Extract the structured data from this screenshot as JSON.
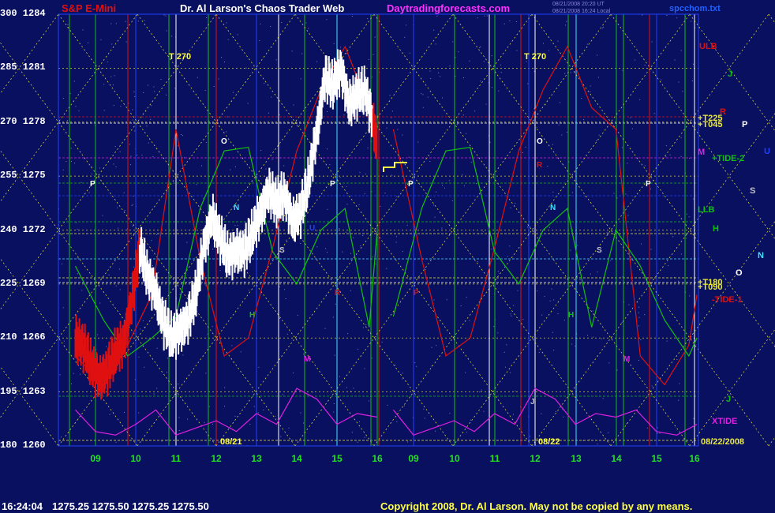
{
  "header": {
    "instrument": "S&P E-Mini",
    "title": "Dr. Al Larson's Chaos Trader Web",
    "site": "Daytradingforecasts.com",
    "file": "spcchom.txt",
    "tiny_line1": "08/21/2008 20:20 UT",
    "tiny_line2": "08/21/2008 16:24 Local"
  },
  "footer": {
    "time": "16:24:04",
    "quote": "1275.25 1275.50 1275.25 1275.50",
    "copyright": "Copyright 2008, Dr. Al Larson. May not be copied by any means."
  },
  "colors": {
    "background": "#0a1060",
    "price_bar": "#ffffff",
    "red": "#e01010",
    "green": "#10c010",
    "magenta": "#e020e0",
    "yellow_grid": "#e8e840",
    "blue_line": "#2040ff",
    "cyan_line": "#40e0ff"
  },
  "chart_data": {
    "type": "line",
    "title": "S&P E-Mini",
    "y_axis": {
      "left_labels": [
        "300",
        "285",
        "270",
        "255",
        "240",
        "225",
        "210",
        "195",
        "180"
      ],
      "right_labels": [
        "1284",
        "1281",
        "1278",
        "1275",
        "1272",
        "1269",
        "1266",
        "1263",
        "1260"
      ],
      "price_range": [
        1260,
        1284
      ],
      "wave_range": [
        180,
        300
      ]
    },
    "x_axis": {
      "hour_ticks": [
        "09",
        "10",
        "11",
        "12",
        "13",
        "14",
        "15",
        "16",
        "09",
        "10",
        "11",
        "12",
        "13",
        "14",
        "15",
        "16"
      ],
      "dates": [
        "08/21",
        "08/22"
      ]
    },
    "vertical_labels": [
      "T 270",
      "T 270"
    ],
    "price_series": {
      "name": "S&P E-Mini price",
      "x_hours": [
        8.5,
        8.7,
        8.9,
        9.1,
        9.3,
        9.5,
        9.7,
        9.9,
        10.1,
        10.3,
        10.5,
        10.7,
        10.9,
        11.1,
        11.3,
        11.5,
        11.7,
        11.9,
        12.1,
        12.3,
        12.5,
        12.7,
        12.9,
        13.1,
        13.3,
        13.5,
        13.7,
        13.9,
        14.1,
        14.3,
        14.5,
        14.7,
        14.9,
        15.1,
        15.3,
        15.5,
        15.7,
        15.9,
        16.0
      ],
      "y_price": [
        1266.0,
        1265.5,
        1264.5,
        1263.8,
        1264.2,
        1265.2,
        1265.8,
        1268.0,
        1271.0,
        1269.5,
        1268.5,
        1266.8,
        1266.0,
        1266.5,
        1267.0,
        1268.5,
        1271.2,
        1272.8,
        1271.5,
        1270.5,
        1270.9,
        1270.8,
        1271.8,
        1273.0,
        1274.2,
        1273.5,
        1274.0,
        1272.5,
        1273.0,
        1274.8,
        1277.5,
        1280.5,
        1280.0,
        1281.0,
        1279.0,
        1279.5,
        1279.8,
        1278.0,
        1276.5
      ]
    },
    "wave_series": [
      {
        "name": "red",
        "color": "#e01010",
        "x_hours": [
          8.5,
          9.2,
          9.8,
          10.4,
          11.0,
          11.6,
          12.2,
          12.8,
          13.4,
          14.0,
          14.6,
          15.2,
          15.8,
          16.0
        ],
        "y": [
          205,
          197,
          208,
          222,
          268,
          232,
          205,
          210,
          235,
          262,
          279,
          291,
          274,
          268
        ]
      },
      {
        "name": "green",
        "color": "#10c010",
        "x_hours": [
          8.5,
          9.2,
          9.8,
          10.4,
          11.0,
          11.6,
          12.2,
          12.8,
          13.4,
          14.0,
          14.6,
          15.2,
          15.8,
          16.0
        ],
        "y": [
          230,
          215,
          205,
          210,
          216,
          246,
          262,
          263,
          234,
          225,
          240,
          246,
          213,
          240
        ]
      },
      {
        "name": "xtide",
        "color": "#e020e0",
        "x_hours": [
          8.5,
          9.0,
          9.5,
          10.0,
          10.5,
          11.0,
          11.5,
          12.0,
          12.5,
          13.0,
          13.5,
          14.0,
          14.5,
          15.0,
          15.5,
          16.0
        ],
        "y": [
          190,
          184,
          183,
          186,
          190,
          183,
          185,
          187,
          184,
          189,
          186,
          196,
          193,
          186,
          189,
          188
        ]
      }
    ],
    "right_labels": [
      {
        "text": "ULB",
        "color": "#e01010"
      },
      {
        "text": "J",
        "color": "#10c010"
      },
      {
        "text": "R",
        "color": "#e01010"
      },
      {
        "text": "+T225",
        "color": "#e8e840"
      },
      {
        "text": "+T045",
        "color": "#e8e840"
      },
      {
        "text": "P",
        "color": "#ffffff"
      },
      {
        "text": "U",
        "color": "#2040ff"
      },
      {
        "text": "M",
        "color": "#e020e0"
      },
      {
        "text": "+TIDE-2",
        "color": "#10c010"
      },
      {
        "text": "S",
        "color": "#c0c0c0"
      },
      {
        "text": "LLB",
        "color": "#10c010"
      },
      {
        "text": "H",
        "color": "#10c010"
      },
      {
        "text": "N",
        "color": "#40e0ff"
      },
      {
        "text": "O",
        "color": "#ffffff"
      },
      {
        "text": "+T180",
        "color": "#e8e840"
      },
      {
        "text": "+T090",
        "color": "#e8e840"
      },
      {
        "text": "-TIDE-1",
        "color": "#e01010"
      },
      {
        "text": "J",
        "color": "#10c010"
      },
      {
        "text": "XTIDE",
        "color": "#e020e0"
      },
      {
        "text": "08/22/2008",
        "color": "#e8e840"
      }
    ],
    "plot_letters": [
      "P",
      "O",
      "N",
      "S",
      "U",
      "H",
      "R",
      "M",
      "J",
      "P",
      "P",
      "P",
      "O",
      "N",
      "S",
      "R",
      "H",
      "M",
      "P"
    ]
  }
}
